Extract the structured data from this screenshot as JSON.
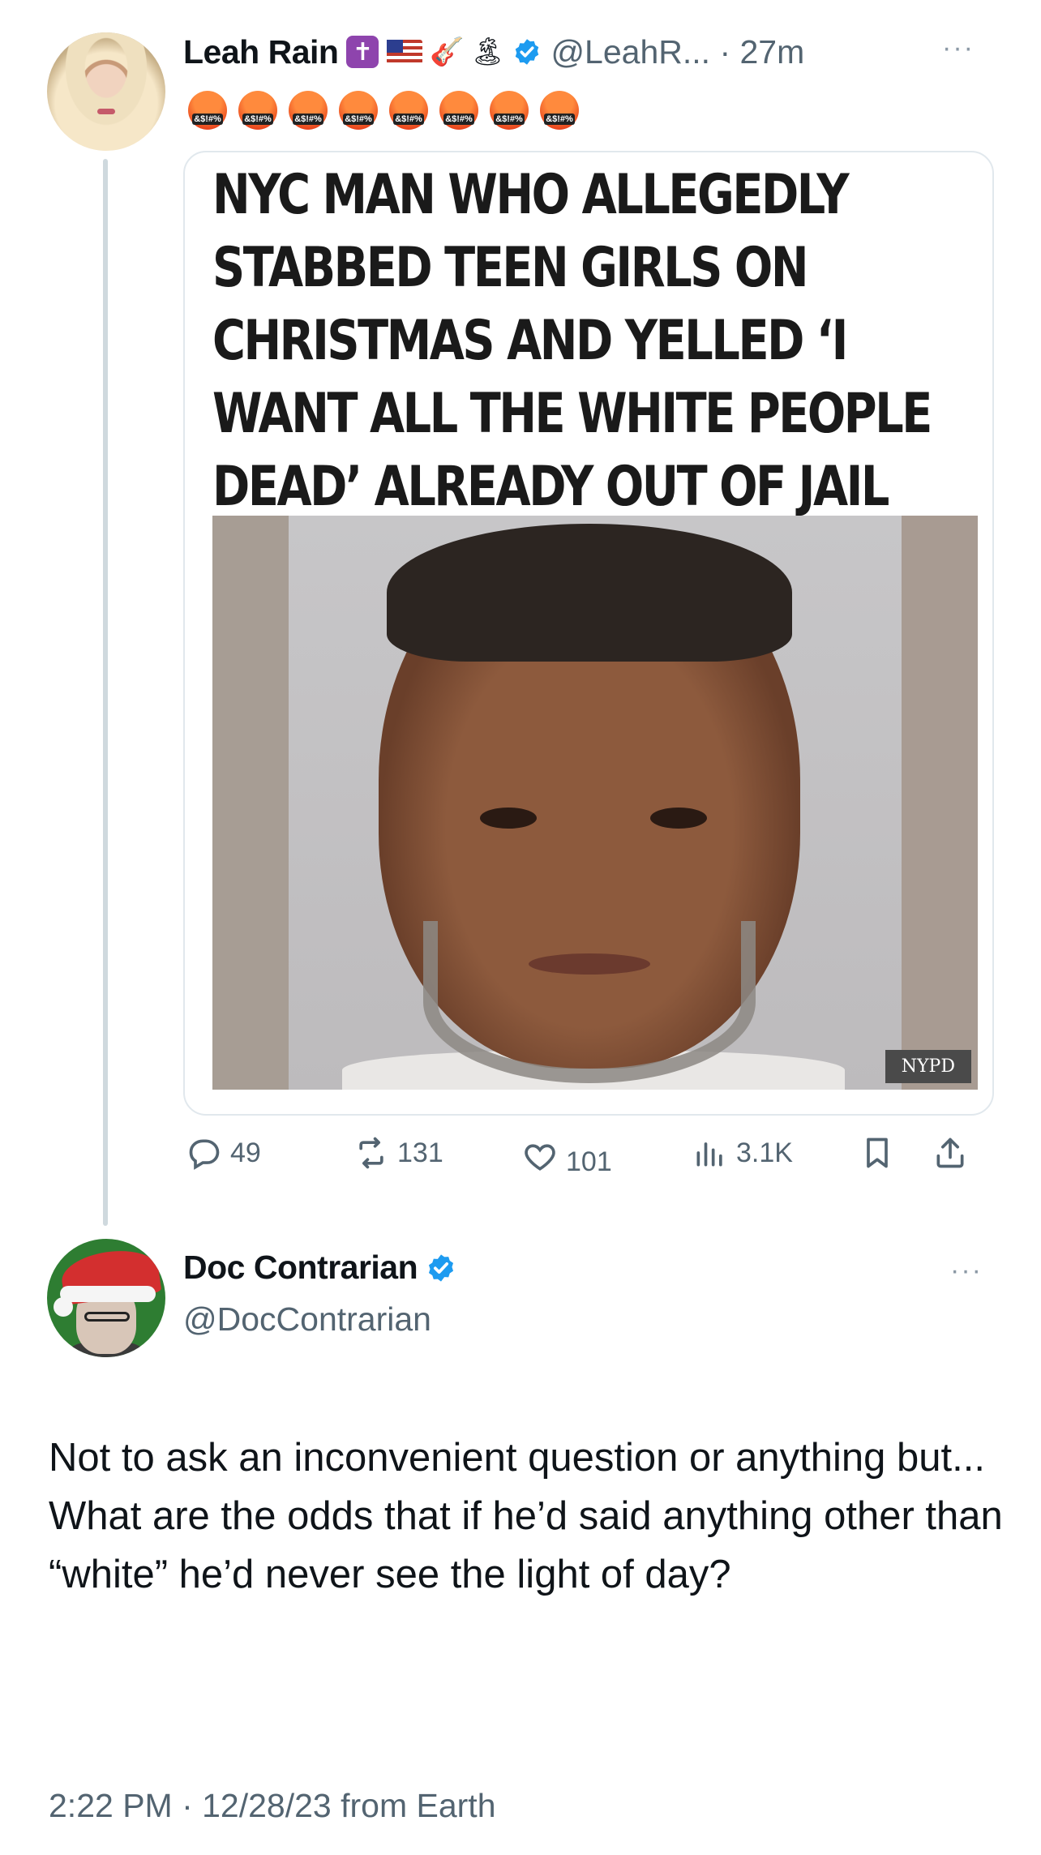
{
  "tweet1": {
    "display_name": "Leah Rain",
    "name_emojis": [
      "cross-emoji",
      "us-flag-emoji",
      "guitar-emoji",
      "island-emoji"
    ],
    "handle_time": "@LeahR... · 27m",
    "more_label": "···",
    "angry_emoji_text": "&$!#%",
    "angry_emoji_count": 8,
    "card": {
      "headline": "NYC MAN WHO ALLEGEDLY STABBED TEEN GIRLS ON CHRISTMAS AND YELLED ‘I WANT ALL THE WHITE PEOPLE DEAD’ ALREADY OUT OF JAIL",
      "photo_credit": "NYPD"
    },
    "actions": {
      "replies": "49",
      "reposts": "131",
      "likes": "101",
      "views": "3.1K"
    }
  },
  "tweet2": {
    "display_name": "Doc Contrarian",
    "handle": "@DocContrarian",
    "more_label": "···",
    "text": "Not to ask an inconvenient question or anything but...\nWhat are the odds that if he’d said anything other than “white” he’d never see the light of day?",
    "timestamp": "2:22 PM · 12/28/23 from Earth"
  },
  "colors": {
    "verified_blue": "#1d9bf0",
    "secondary_text": "#536471",
    "thread_line": "#cfd9de"
  }
}
